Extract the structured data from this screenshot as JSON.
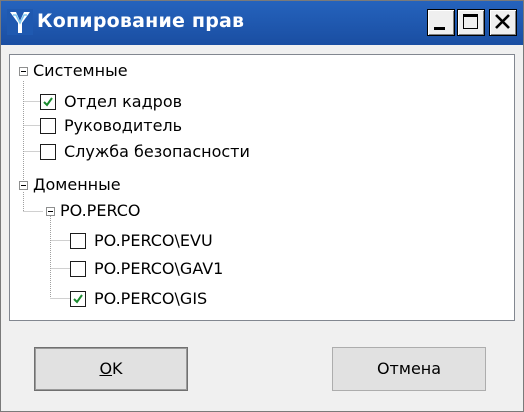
{
  "window": {
    "title": "Копирование прав",
    "icon": "perco-logo-icon",
    "controls": {
      "minimize": "minimize-icon",
      "maximize": "maximize-icon",
      "close": "close-icon"
    },
    "accent": "#1f59b0"
  },
  "tree": {
    "groups": [
      {
        "label": "Системные",
        "expanded": true,
        "items": [
          {
            "label": "Отдел кадров",
            "checked": true
          },
          {
            "label": "Руководитель",
            "checked": false
          },
          {
            "label": "Служба безопасности",
            "checked": false
          }
        ]
      },
      {
        "label": "Доменные",
        "expanded": true,
        "subgroups": [
          {
            "label": "PO.PERCO",
            "expanded": true,
            "items": [
              {
                "label": "PO.PERCO\\EVU",
                "checked": false
              },
              {
                "label": "PO.PERCO\\GAV1",
                "checked": false
              },
              {
                "label": "PO.PERCO\\GIS",
                "checked": true
              }
            ]
          }
        ]
      }
    ]
  },
  "buttons": {
    "ok_mnemonic": "O",
    "ok_rest": "K",
    "cancel": "Отмена"
  }
}
